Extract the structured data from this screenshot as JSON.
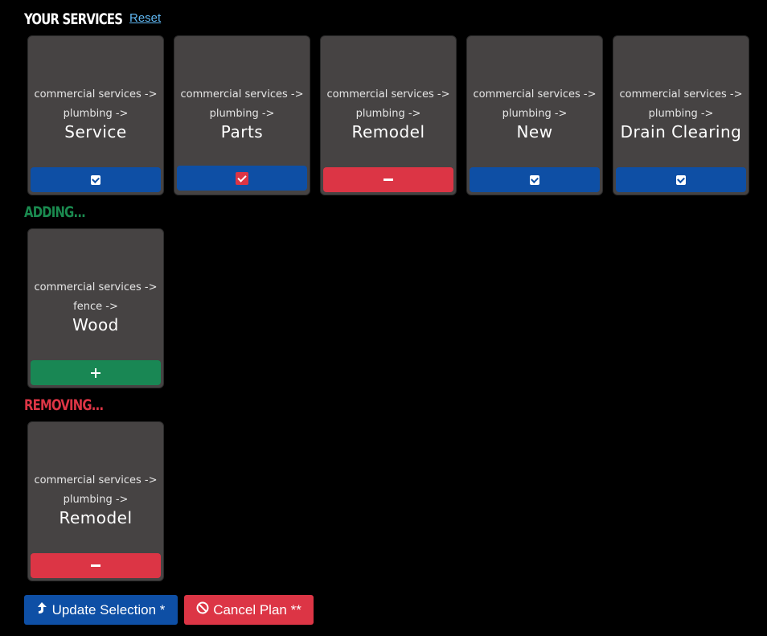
{
  "colors": {
    "card_bg": "#464343",
    "blue": "#0e4fa5",
    "red": "#dc3545",
    "green": "#198754",
    "link": "#5fb6f0",
    "title_white": "#ffffff",
    "title_green": "#1a8a4f",
    "title_red": "#dc3545"
  },
  "header": {
    "title": "YOUR SERVICES",
    "reset_label": "Reset"
  },
  "your_services": [
    {
      "crumb1": "commercial services ->",
      "crumb2": "plumbing ->",
      "name": "Service",
      "button": "check",
      "button_color": "blue"
    },
    {
      "crumb1": "commercial services ->",
      "crumb2": "plumbing ->",
      "name": "Parts",
      "button": "check-highlight",
      "button_color": "blue"
    },
    {
      "crumb1": "commercial services ->",
      "crumb2": "plumbing ->",
      "name": "Remodel",
      "button": "minus",
      "button_color": "red"
    },
    {
      "crumb1": "commercial services ->",
      "crumb2": "plumbing ->",
      "name": "New",
      "button": "check",
      "button_color": "blue"
    },
    {
      "crumb1": "commercial services ->",
      "crumb2": "plumbing ->",
      "name": "Drain Clearing",
      "button": "check",
      "button_color": "blue"
    }
  ],
  "adding": {
    "title": "ADDING...",
    "items": [
      {
        "crumb1": "commercial services ->",
        "crumb2": "fence ->",
        "name": "Wood",
        "button": "plus",
        "button_color": "green"
      }
    ]
  },
  "removing": {
    "title": "REMOVING...",
    "items": [
      {
        "crumb1": "commercial services ->",
        "crumb2": "plumbing ->",
        "name": "Remodel",
        "button": "minus",
        "button_color": "red"
      }
    ]
  },
  "actions": {
    "update_label": "Update Selection *",
    "update_icon": "share-arrow-icon",
    "cancel_label": "Cancel Plan **",
    "cancel_icon": "ban-icon"
  }
}
